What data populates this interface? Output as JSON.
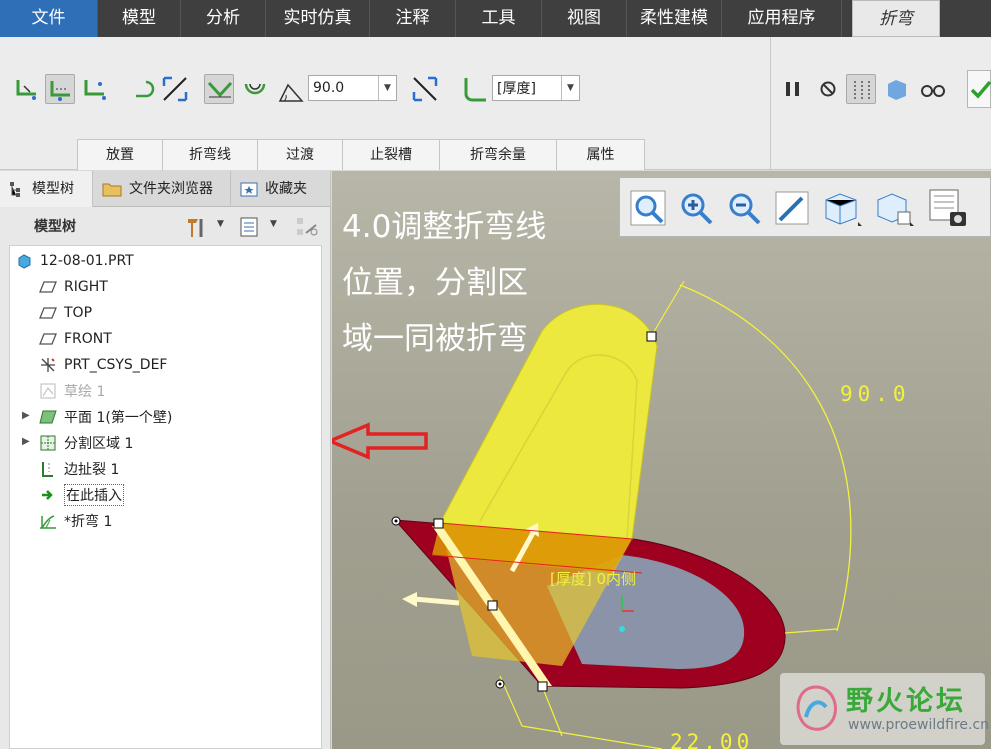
{
  "menubar": {
    "items": [
      "文件",
      "模型",
      "分析",
      "实时仿真",
      "注释",
      "工具",
      "视图",
      "柔性建模",
      "应用程序"
    ],
    "active_tab": "折弯"
  },
  "ribbon": {
    "angle_value": "90.0",
    "thickness_option": "[厚度]",
    "subtabs": [
      "放置",
      "折弯线",
      "过渡",
      "止裂槽",
      "折弯余量",
      "属性"
    ]
  },
  "panel": {
    "tabs": [
      "模型树",
      "文件夹浏览器",
      "收藏夹"
    ],
    "tree_title": "模型树",
    "tree": [
      {
        "label": "12-08-01.PRT",
        "icon": "part-icon"
      },
      {
        "label": "RIGHT",
        "icon": "datum-plane-icon"
      },
      {
        "label": "TOP",
        "icon": "datum-plane-icon"
      },
      {
        "label": "FRONT",
        "icon": "datum-plane-icon"
      },
      {
        "label": "PRT_CSYS_DEF",
        "icon": "csys-icon"
      },
      {
        "label": "草绘 1",
        "icon": "sketch-icon"
      },
      {
        "label": "平面 1(第一个壁)",
        "icon": "wall-icon"
      },
      {
        "label": "分割区域 1",
        "icon": "split-region-icon"
      },
      {
        "label": "边扯裂 1",
        "icon": "edge-rip-icon"
      },
      {
        "label": "在此插入",
        "icon": "insert-here-icon"
      },
      {
        "label": "*折弯 1",
        "icon": "bend-icon"
      }
    ]
  },
  "viewport": {
    "caption_lines": [
      "4.0调整折弯线",
      "位置，分割区",
      "域一同被折弯"
    ],
    "dim_angle": "90.0",
    "dim_length": "22.00",
    "dim_thickness_note": "[厚度] 0内侧"
  },
  "watermark": {
    "title": "野火论坛",
    "url": "www.proewildfire.cn"
  },
  "colors": {
    "menubar_bg": "#3f3f3f",
    "file_tab": "#2f6fb7",
    "bend_yellow": "#f0ec3a",
    "part_red": "#9e0020",
    "dimension_yellow": "#f2f23c",
    "annotation_red": "#e32222"
  }
}
